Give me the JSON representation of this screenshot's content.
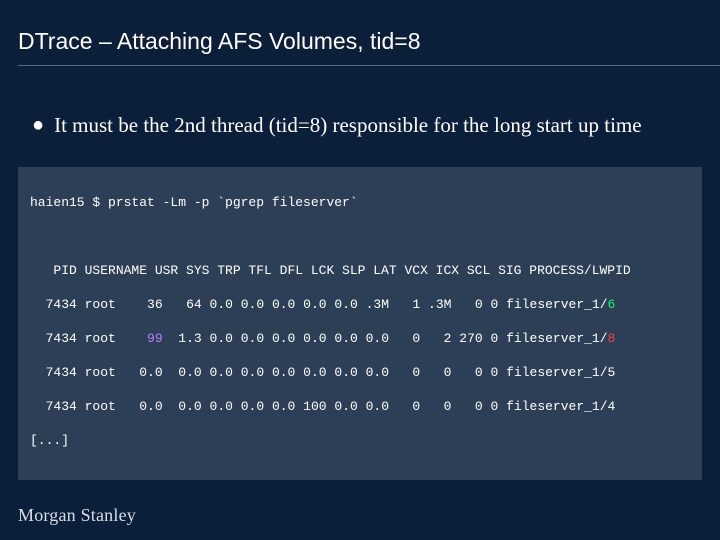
{
  "title": "DTrace – Attaching AFS Volumes, tid=8",
  "bullet": "It must be the 2nd thread (tid=8) responsible for the long start up time",
  "terminal": {
    "prompt": "haien15 $ prstat -Lm -p `pgrep fileserver`",
    "header": "   PID USERNAME USR SYS TRP TFL DFL LCK SLP LAT VCX ICX SCL SIG PROCESS/LWPID",
    "rows": [
      {
        "pid": "  7434",
        "user": "root",
        "usr": "   36",
        "sys": "  64",
        "trp": "0.0",
        "tfl": "0.0",
        "dfl": "0.0",
        "lck": "0.0",
        "slp": "0.0",
        "lat": ".3M",
        "vcx": "  1",
        "icx": ".3M",
        "scl": "  0",
        "sig": "0",
        "proc": "fileserver_1/",
        "lwp": "6",
        "hl": "green"
      },
      {
        "pid": "  7434",
        "user": "root",
        "usr": "   99",
        "sys": " 1.3",
        "trp": "0.0",
        "tfl": "0.0",
        "dfl": "0.0",
        "lck": "0.0",
        "slp": "0.0",
        "lat": "0.0",
        "vcx": "  0",
        "icx": "  2",
        "scl": "270",
        "sig": "0",
        "proc": "fileserver_1/",
        "lwp": "8",
        "hl": "red"
      },
      {
        "pid": "  7434",
        "user": "root",
        "usr": "  0.0",
        "sys": " 0.0",
        "trp": "0.0",
        "tfl": "0.0",
        "dfl": "0.0",
        "lck": "0.0",
        "slp": "0.0",
        "lat": "0.0",
        "vcx": "  0",
        "icx": "  0",
        "scl": "  0",
        "sig": "0",
        "proc": "fileserver_1/5",
        "lwp": "",
        "hl": ""
      },
      {
        "pid": "  7434",
        "user": "root",
        "usr": "  0.0",
        "sys": " 0.0",
        "trp": "0.0",
        "tfl": "0.0",
        "dfl": "0.0",
        "lck": "100",
        "slp": "0.0",
        "lat": "0.0",
        "vcx": "  0",
        "icx": "  0",
        "scl": "  0",
        "sig": "0",
        "proc": "fileserver_1/4",
        "lwp": "",
        "hl": ""
      }
    ],
    "ellipsis": "[...]"
  },
  "footer": "Morgan Stanley"
}
